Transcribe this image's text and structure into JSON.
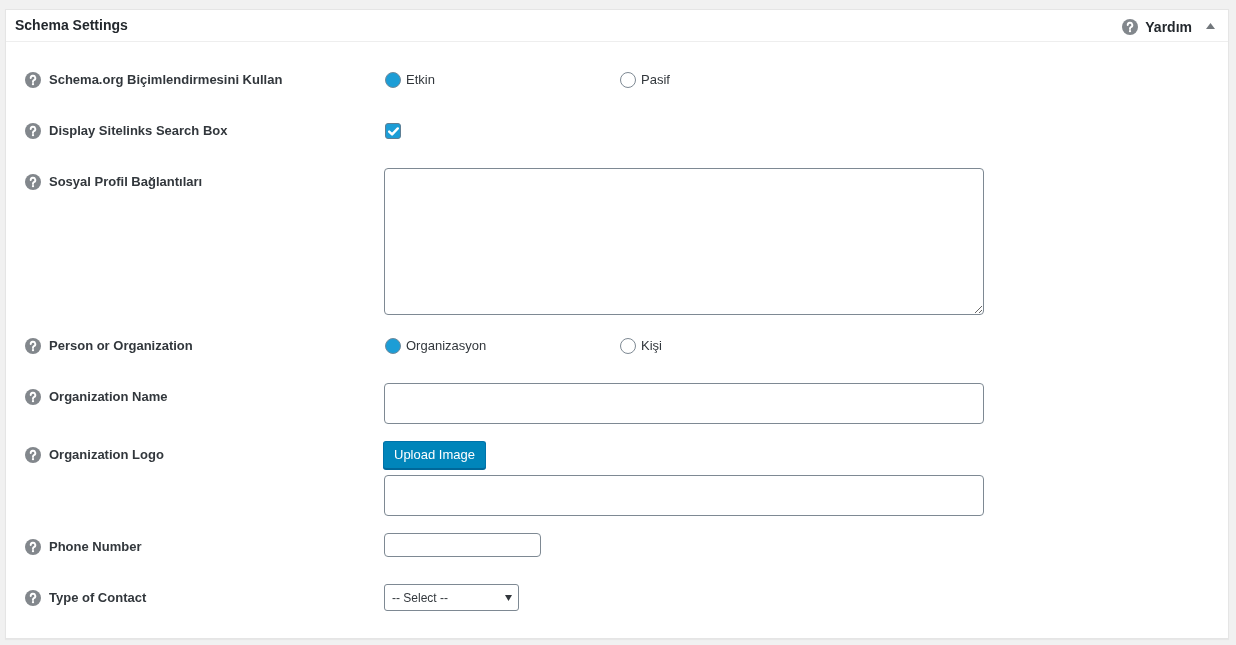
{
  "panel": {
    "title": "Schema Settings",
    "help_label": "Yardım",
    "expanded": true
  },
  "fields": [
    {
      "kind": "radio",
      "label": "Schema.org Biçimlendirmesini Kullan",
      "options": [
        {
          "label": "Etkin",
          "selected": true
        },
        {
          "label": "Pasif",
          "selected": false
        }
      ]
    },
    {
      "kind": "checkbox",
      "label": "Display Sitelinks Search Box",
      "checked": true
    },
    {
      "kind": "textarea",
      "label": "Sosyal Profil Bağlantıları"
    },
    {
      "kind": "radio",
      "label": "Person or Organization",
      "options": [
        {
          "label": "Organizasyon",
          "selected": true
        },
        {
          "label": "Kişi",
          "selected": false
        }
      ]
    },
    {
      "kind": "text",
      "label": "Organization Name"
    },
    {
      "kind": "upload",
      "label": "Organization Logo",
      "button": "Upload Image"
    },
    {
      "kind": "short_text",
      "label": "Phone Number"
    },
    {
      "kind": "select",
      "label": "Type of Contact",
      "value": "-- Select --"
    }
  ]
}
